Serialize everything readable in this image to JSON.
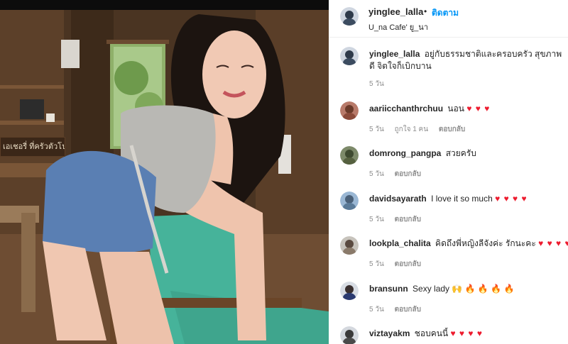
{
  "post": {
    "username": "yinglee_lalla",
    "dot": "•",
    "follow_label": "ติดตาม",
    "location": "U_na Cafe' ยู_นา",
    "sign_text": "เอเชอรี่ ที่ครัวตัวโป"
  },
  "comments": [
    {
      "username": "yinglee_lalla",
      "text": "อยู่กับธรรมชาติและครอบครัว สุขภาพดี จิตใจก็เบิกบาน",
      "time": "5 วัน",
      "likes": "",
      "reply": "",
      "hearts": ""
    },
    {
      "username": "aariicchanthrchuu",
      "text": "นอน",
      "hearts": "♥ ♥ ♥",
      "time": "5 วัน",
      "likes": "ถูกใจ 1 คน",
      "reply": "ตอบกลับ"
    },
    {
      "username": "domrong_pangpa",
      "text": "สวยครับ",
      "hearts": "",
      "time": "5 วัน",
      "likes": "",
      "reply": "ตอบกลับ"
    },
    {
      "username": "davidsayarath",
      "text": "I love it so much",
      "hearts": "♥ ♥ ♥ ♥",
      "time": "5 วัน",
      "likes": "",
      "reply": "ตอบกลับ"
    },
    {
      "username": "lookpla_chalita",
      "text": "คิดถึงพี่หญิงลีจังค่ะ รักนะคะ",
      "hearts": "♥ ♥ ♥ ♥",
      "time": "5 วัน",
      "likes": "",
      "reply": "ตอบกลับ"
    },
    {
      "username": "bransunn",
      "text": "Sexy lady 🙌 🔥 🔥 🔥 🔥",
      "hearts": "",
      "time": "5 วัน",
      "likes": "",
      "reply": "ตอบกลับ"
    },
    {
      "username": "viztayakm",
      "text": "ชอบคนนี้",
      "hearts": "♥ ♥ ♥ ♥",
      "time": "",
      "likes": "",
      "reply": ""
    }
  ],
  "colors": {
    "link_blue": "#0095f6",
    "heart_red": "#ed1b2e",
    "meta_gray": "#8e8e8e"
  }
}
